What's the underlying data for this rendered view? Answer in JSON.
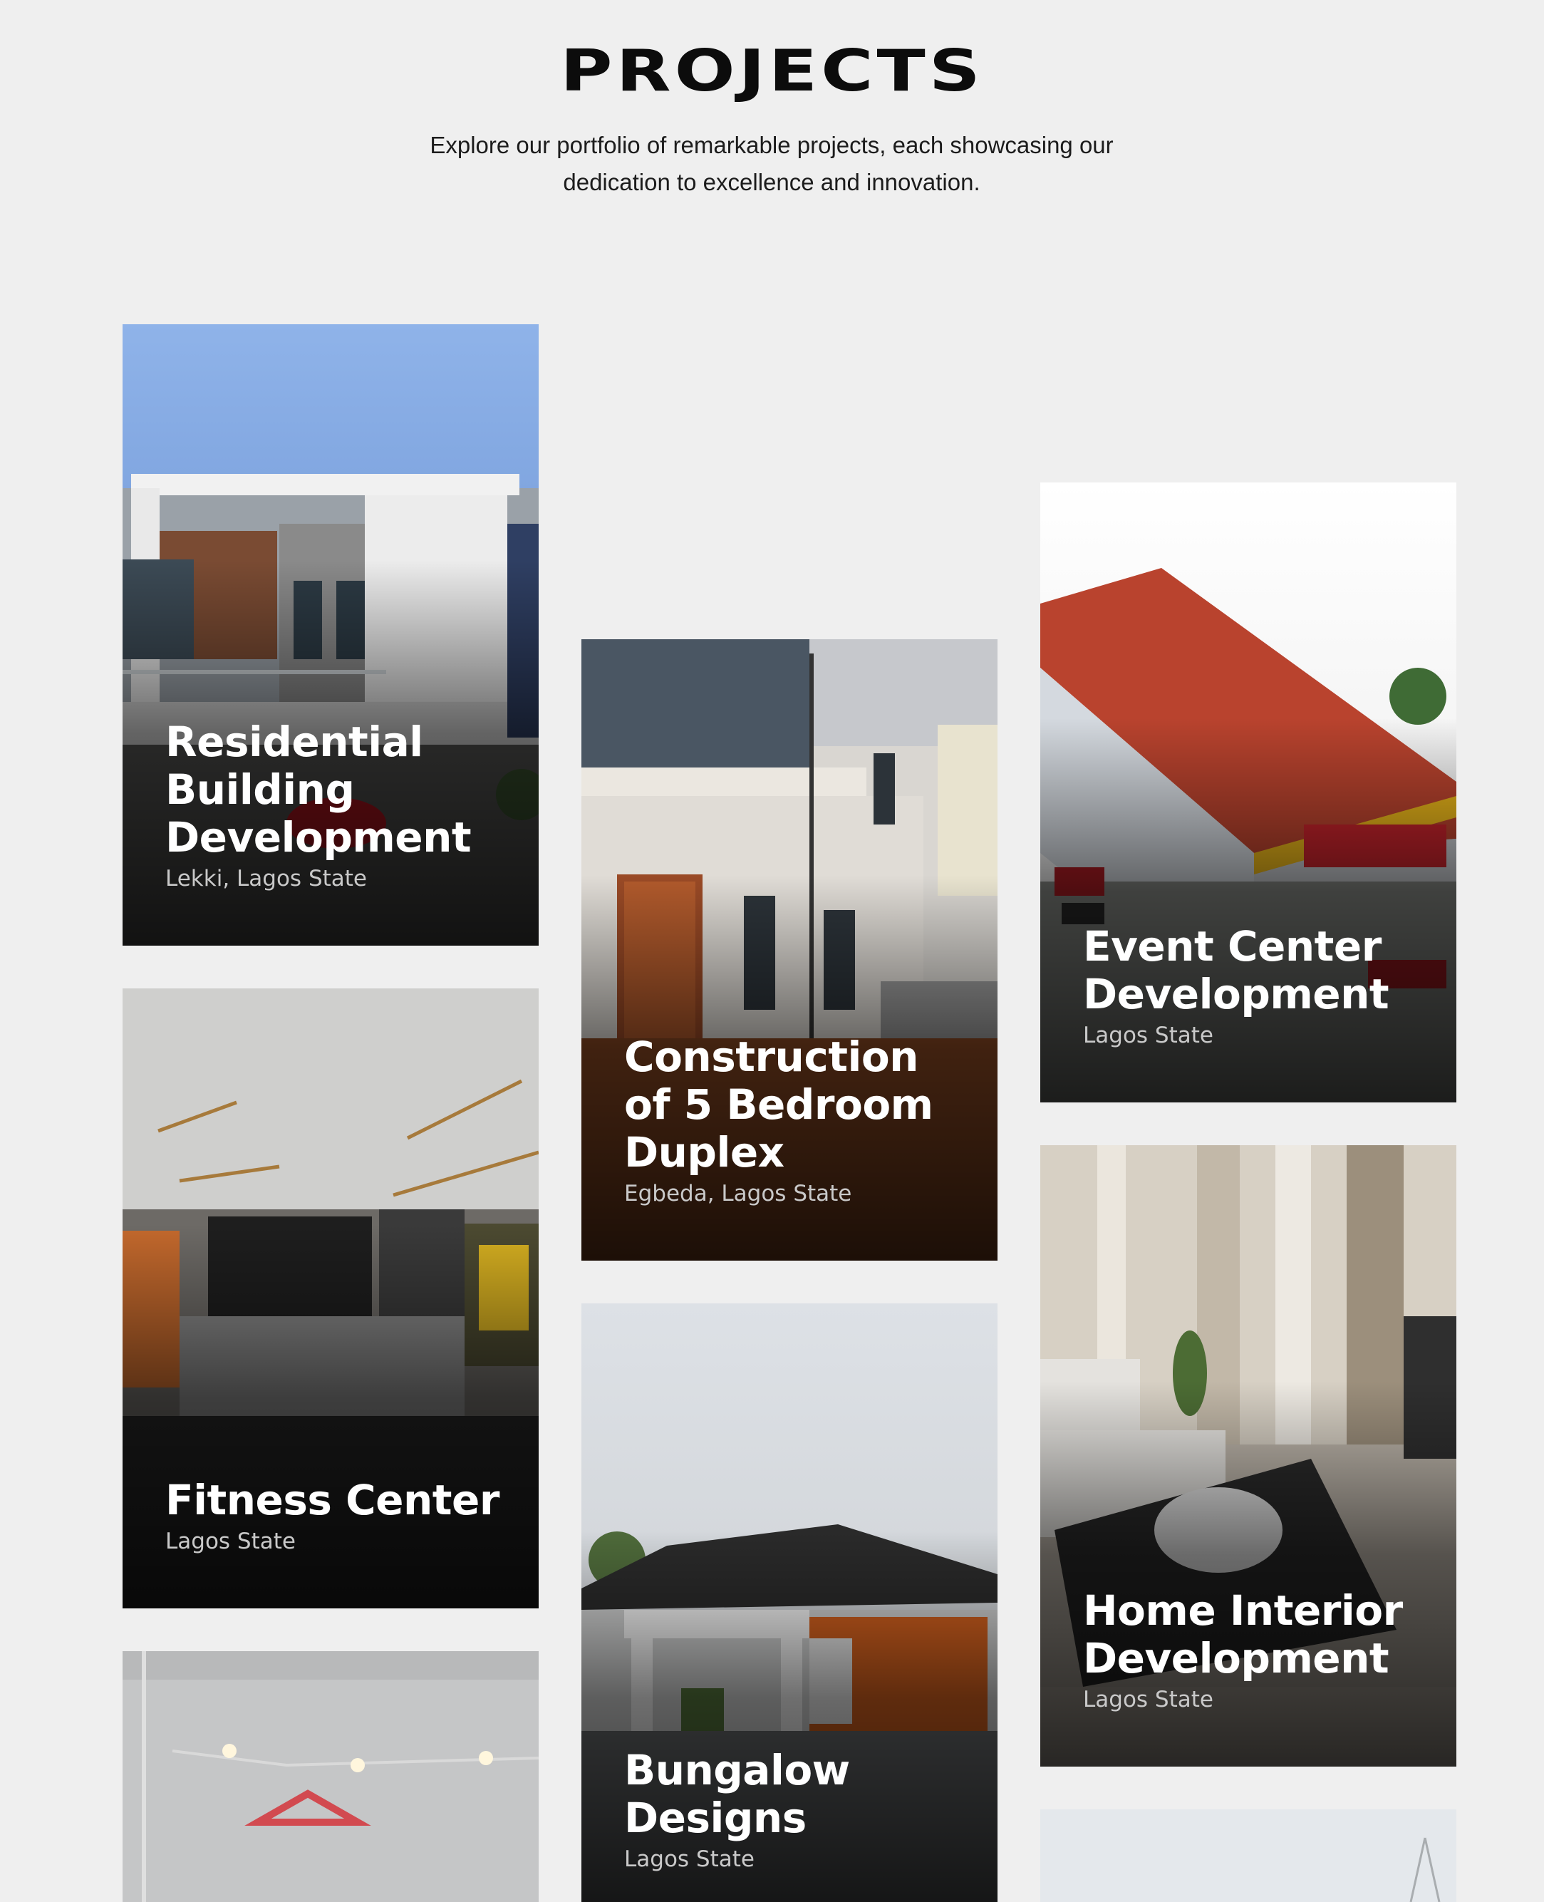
{
  "header": {
    "title": "PROJECTS",
    "subtitle": "Explore our portfolio of remarkable projects, each showcasing our dedication to excellence and innovation."
  },
  "projects": [
    {
      "title": "Residential Building Development",
      "location": "Lekki, Lagos State"
    },
    {
      "title": "Construction of 5 Bedroom Duplex",
      "location": "Egbeda, Lagos State"
    },
    {
      "title": "Event Center Development",
      "location": "Lagos State"
    },
    {
      "title": "Fitness Center",
      "location": "Lagos State"
    },
    {
      "title": "Home Interior Development",
      "location": "Lagos State"
    },
    {
      "title": "Bungalow Designs",
      "location": "Lagos State"
    }
  ],
  "colors": {
    "background": "#efefef",
    "heading": "#0c0c0c",
    "card_title": "#ffffff",
    "card_location": "#c9c9c9"
  }
}
